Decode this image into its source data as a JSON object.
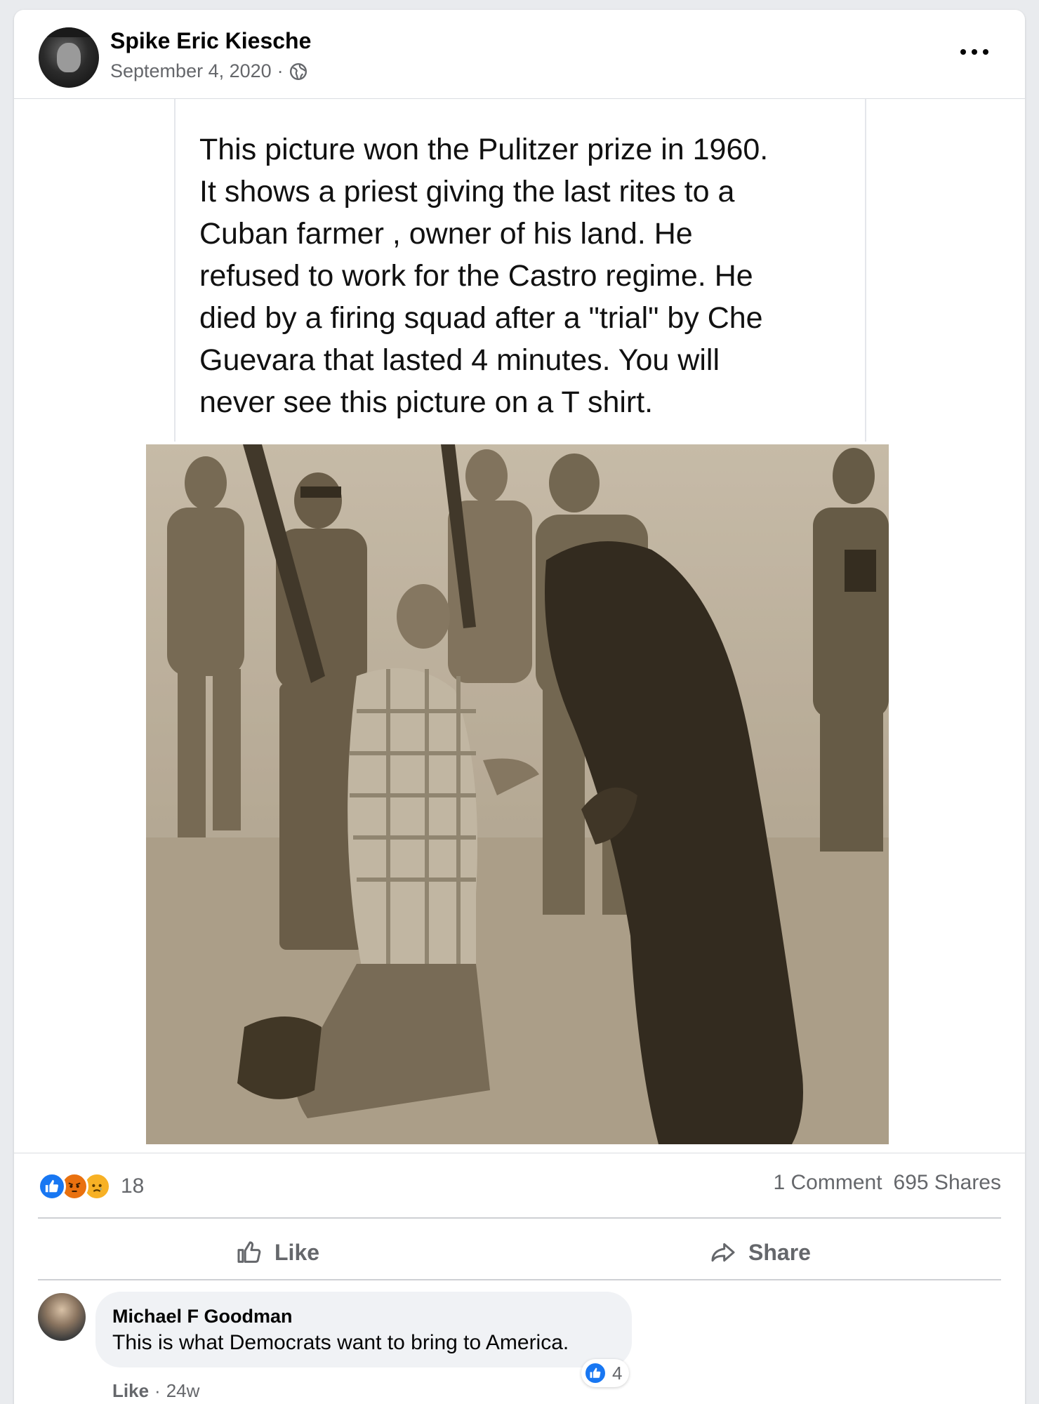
{
  "post": {
    "author": "Spike Eric Kiesche",
    "date": "September 4, 2020",
    "meta_separator": "·",
    "privacy_icon": "globe-icon",
    "menu_icon": "more-icon",
    "text_lines": [
      "This picture won the Pulitzer prize in 1960.",
      "It shows a priest giving the last rites to a",
      "Cuban farmer , owner of his land. He",
      "refused to work for the Castro regime. He",
      "died by a firing squad after a \"trial\" by Che",
      "Guevara that lasted 4 minutes. You will",
      "never see this picture on a T shirt."
    ],
    "photo": "sepia-photograph"
  },
  "engagement": {
    "reactions": [
      "like",
      "angry",
      "sad"
    ],
    "reaction_colors": {
      "like": "#1877f2",
      "angry": "#e9710f",
      "sad": "#f7b125"
    },
    "reaction_count": "18",
    "comments": "1 Comment",
    "shares": "695 Shares"
  },
  "actions": {
    "like_label": "Like",
    "share_label": "Share"
  },
  "comment": {
    "author": "Michael F Goodman",
    "text": "This is what Democrats want to bring to America.",
    "reaction_count": "4",
    "like_label": "Like",
    "separator": "·",
    "age": "24w"
  }
}
